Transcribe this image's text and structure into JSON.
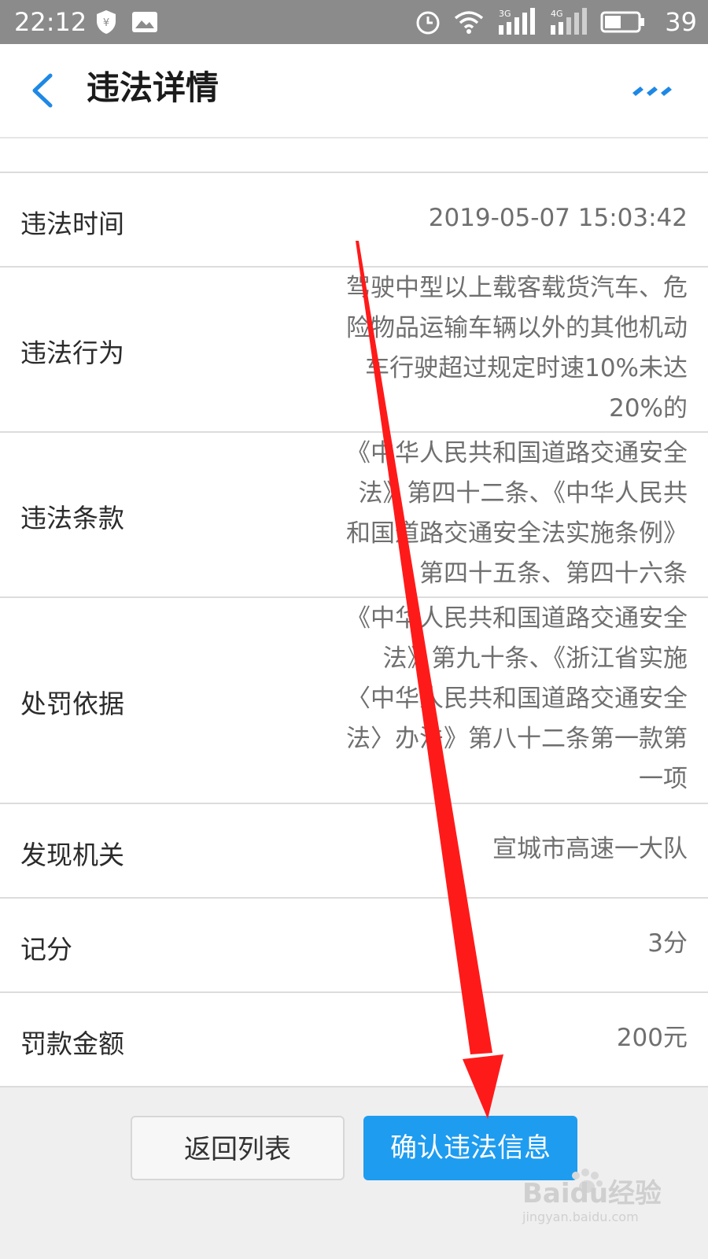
{
  "status_bar": {
    "time": "22:12",
    "battery_percent": "39",
    "network_1": "3G",
    "network_2": "4G",
    "icons": [
      "shield-yen-icon",
      "image-icon",
      "alarm-icon",
      "wifi-icon",
      "signal-3g-icon",
      "signal-4g-icon",
      "battery-icon"
    ]
  },
  "nav": {
    "title": "违法详情",
    "back_icon": "chevron-left-icon",
    "more_icon": "more-dots-icon"
  },
  "details": [
    {
      "label": "违法时间",
      "value_lines": [
        "2019-05-07 15:03:42"
      ]
    },
    {
      "label": "违法行为",
      "value_lines": [
        "驾驶中型以上载客载货汽车、危",
        "险物品运输车辆以外的其他机动",
        "车行驶超过规定时速10%未达",
        "20%的"
      ]
    },
    {
      "label": "违法条款",
      "value_lines": [
        "《中华人民共和国道路交通安全",
        "法》第四十二条、《中华人民共",
        "和国道路交通安全法实施条例》",
        "第四十五条、第四十六条"
      ]
    },
    {
      "label": "处罚依据",
      "value_lines": [
        "《中华人民共和国道路交通安全",
        "法》第九十条、《浙江省实施",
        "〈中华人民共和国道路交通安全",
        "法〉办法》第八十二条第一款第",
        "一项"
      ]
    },
    {
      "label": "发现机关",
      "value_lines": [
        "宣城市高速一大队"
      ]
    },
    {
      "label": "记分",
      "value_lines": [
        "3分"
      ]
    },
    {
      "label": "罚款金额",
      "value_lines": [
        "200元"
      ]
    }
  ],
  "footer": {
    "back_label": "返回列表",
    "confirm_label": "确认违法信息"
  },
  "watermark": {
    "brand": "Baidu经验",
    "url": "jingyan.baidu.com"
  },
  "colors": {
    "accent": "#1e9cf0",
    "annotation_arrow": "#ff1a1a",
    "status_bar": "#8b8b8b"
  }
}
